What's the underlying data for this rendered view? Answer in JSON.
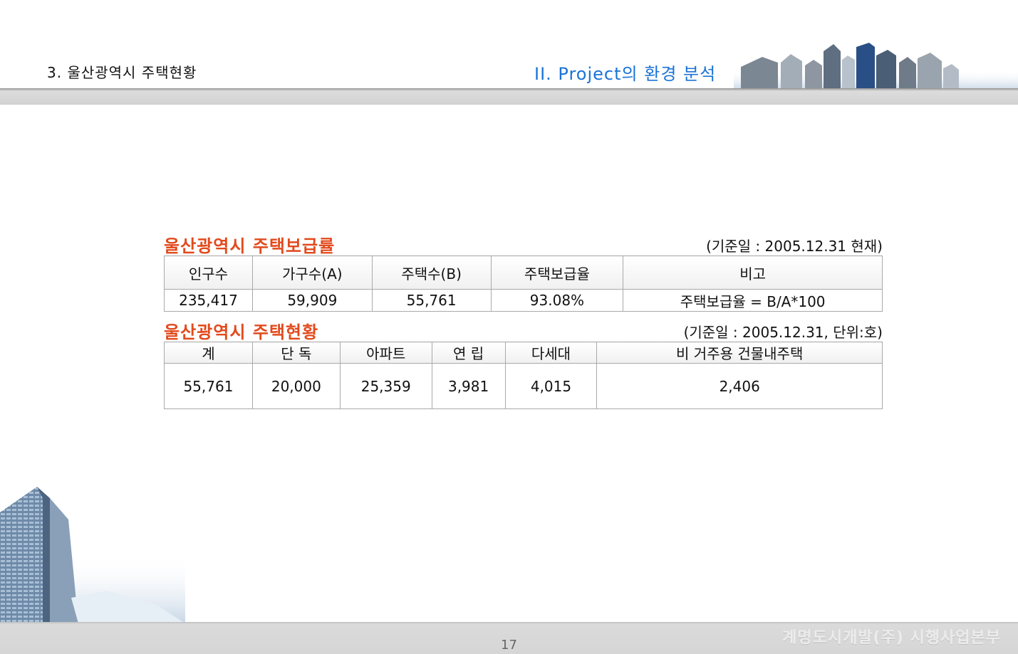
{
  "header": {
    "section": "3. 울산광역시 주택현황",
    "chapter": "II. Project의 환경 분석"
  },
  "supply": {
    "title": "울산광역시 주택보급률",
    "note": "(기준일 : 2005.12.31 현재)",
    "columns": [
      "인구수",
      "가구수(A)",
      "주택수(B)",
      "주택보급율",
      "비고"
    ],
    "row": [
      "235,417",
      "59,909",
      "55,761",
      "93.08%",
      "주택보급율 = B/A*100"
    ]
  },
  "status": {
    "title": "울산광역시 주택현황",
    "note": "(기준일 : 2005.12.31, 단위:호)",
    "columns": [
      "계",
      "단 독",
      "아파트",
      "연 립",
      "다세대",
      "비 거주용 건물내주택"
    ],
    "row": [
      "55,761",
      "20,000",
      "25,359",
      "3,981",
      "4,015",
      "2,406"
    ]
  },
  "footer": {
    "page": "17",
    "company": "계명도시개발(주) 시행사업본부"
  },
  "colors": {
    "accent_blue": "#1a73d6",
    "title_red": "#e24a1d",
    "border": "#a9a9a9"
  }
}
